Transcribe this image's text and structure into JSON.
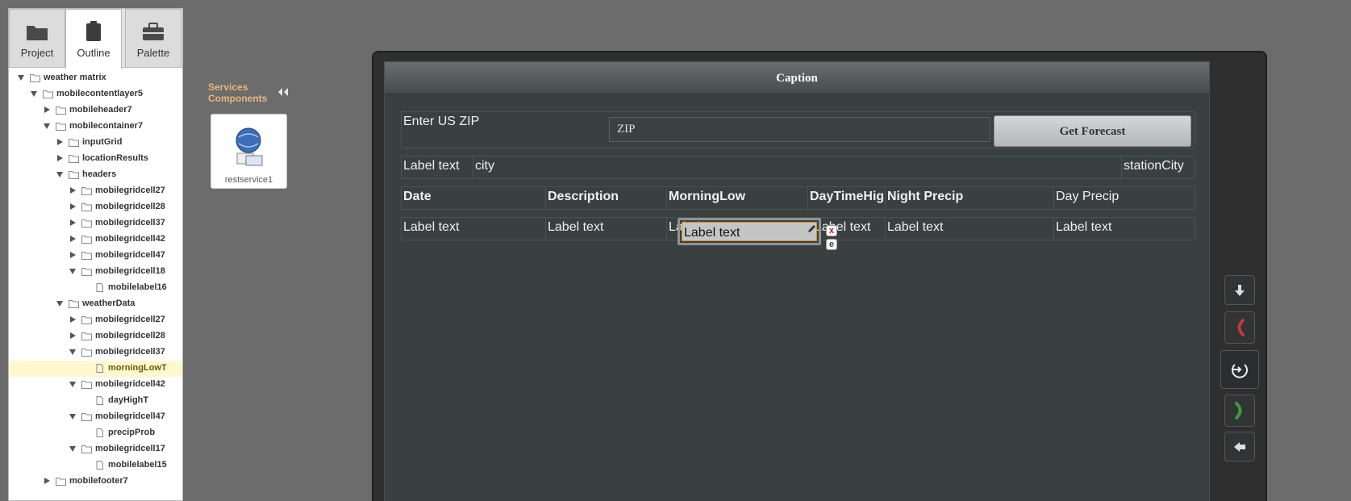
{
  "tabs": [
    {
      "label": "Project",
      "icon": "folder-icon"
    },
    {
      "label": "Outline",
      "icon": "clipboard-icon",
      "active": true
    },
    {
      "label": "Palette",
      "icon": "toolbox-icon"
    }
  ],
  "outline": [
    {
      "label": "weather matrix",
      "depth": 0,
      "expand": "open",
      "icon": "folder-icon"
    },
    {
      "label": "mobilecontentlayer5",
      "depth": 1,
      "expand": "open",
      "icon": "folder-icon"
    },
    {
      "label": "mobileheader7",
      "depth": 2,
      "expand": "closed",
      "icon": "folder-icon"
    },
    {
      "label": "mobilecontainer7",
      "depth": 2,
      "expand": "open",
      "icon": "folder-icon"
    },
    {
      "label": "inputGrid",
      "depth": 3,
      "expand": "closed",
      "icon": "folder-icon"
    },
    {
      "label": "locationResults",
      "depth": 3,
      "expand": "closed",
      "icon": "folder-icon"
    },
    {
      "label": "headers",
      "depth": 3,
      "expand": "open",
      "icon": "folder-icon"
    },
    {
      "label": "mobilegridcell27",
      "depth": 4,
      "expand": "closed",
      "icon": "folder-icon"
    },
    {
      "label": "mobilegridcell28",
      "depth": 4,
      "expand": "closed",
      "icon": "folder-icon"
    },
    {
      "label": "mobilegridcell37",
      "depth": 4,
      "expand": "closed",
      "icon": "folder-icon"
    },
    {
      "label": "mobilegridcell42",
      "depth": 4,
      "expand": "closed",
      "icon": "folder-icon"
    },
    {
      "label": "mobilegridcell47",
      "depth": 4,
      "expand": "closed",
      "icon": "folder-icon"
    },
    {
      "label": "mobilegridcell18",
      "depth": 4,
      "expand": "open",
      "icon": "folder-icon"
    },
    {
      "label": "mobilelabel16",
      "depth": 5,
      "expand": "none",
      "icon": "file-icon"
    },
    {
      "label": "weatherData",
      "depth": 3,
      "expand": "open",
      "icon": "folder-icon"
    },
    {
      "label": "mobilegridcell27",
      "depth": 4,
      "expand": "closed",
      "icon": "folder-icon"
    },
    {
      "label": "mobilegridcell28",
      "depth": 4,
      "expand": "closed",
      "icon": "folder-icon"
    },
    {
      "label": "mobilegridcell37",
      "depth": 4,
      "expand": "open",
      "icon": "folder-icon"
    },
    {
      "label": "morningLowT",
      "depth": 5,
      "expand": "none",
      "icon": "file-icon",
      "selected": true
    },
    {
      "label": "mobilegridcell42",
      "depth": 4,
      "expand": "open",
      "icon": "folder-icon"
    },
    {
      "label": "dayHighT",
      "depth": 5,
      "expand": "none",
      "icon": "file-icon"
    },
    {
      "label": "mobilegridcell47",
      "depth": 4,
      "expand": "open",
      "icon": "folder-icon"
    },
    {
      "label": "precipProb",
      "depth": 5,
      "expand": "none",
      "icon": "file-icon"
    },
    {
      "label": "mobilegridcell17",
      "depth": 4,
      "expand": "open",
      "icon": "folder-icon"
    },
    {
      "label": "mobilelabel15",
      "depth": 5,
      "expand": "none",
      "icon": "file-icon"
    },
    {
      "label": "mobilefooter7",
      "depth": 2,
      "expand": "closed",
      "icon": "folder-icon"
    }
  ],
  "services": {
    "line1": "Services",
    "line2": "Components",
    "component_label": "restservice1",
    "component_icon": "web-service-globe-icon"
  },
  "screen": {
    "caption": "Caption",
    "zip_label": "Enter US ZIP",
    "zip_placeholder": "ZIP",
    "forecast_button": "Get Forecast",
    "location_row": {
      "label": "Label text",
      "city": "city",
      "station": "stationCity"
    },
    "headers": [
      "Date",
      "Description",
      "MorningLow",
      "DayTimeHigh",
      "Night Precip",
      "Day Precip"
    ],
    "data_row": [
      "Label text",
      "Label text",
      "Label text",
      "Label text",
      "Label text",
      "Label text"
    ],
    "delete_badge": "x",
    "edit_badge": "e"
  },
  "side_buttons": [
    "arrow-down-icon",
    "hang-up-icon",
    "power-icon",
    "call-icon",
    "arrow-left-icon"
  ],
  "colors": {
    "selected_row": "#fdf8cf",
    "services_label": "#e8b77a",
    "selection_border": "#e88a12"
  }
}
